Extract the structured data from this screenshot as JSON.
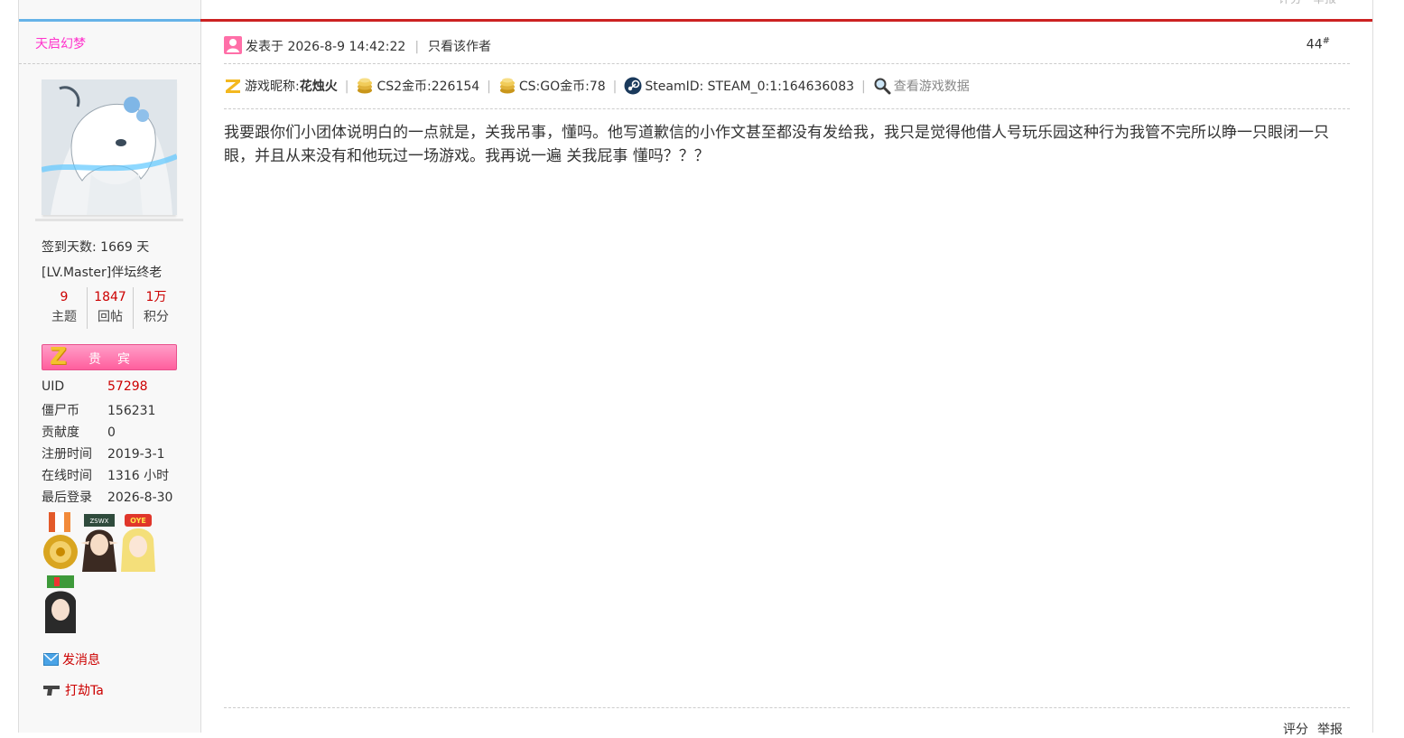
{
  "top_actions": {
    "rate": "评分",
    "report": "举报"
  },
  "sidebar": {
    "username": "天启幻梦",
    "checkin": "签到天数: 1669 天",
    "level": "[LV.Master]伴坛终老",
    "stats": [
      {
        "num": "9",
        "label": "主题"
      },
      {
        "num": "1847",
        "label": "回帖"
      },
      {
        "num": "1万",
        "label": "积分"
      }
    ],
    "vip_label": "贵宾",
    "info": [
      {
        "key": "UID",
        "value": "57298"
      },
      {
        "key": "僵尸币",
        "value": "156231"
      },
      {
        "key": "贡献度",
        "value": "0"
      },
      {
        "key": "注册时间",
        "value": "2019-3-1"
      },
      {
        "key": "在线时间",
        "value": "1316 小时"
      },
      {
        "key": "最后登录",
        "value": "2026-8-30"
      }
    ],
    "send_message": "发消息",
    "rob": "打劫Ta"
  },
  "post": {
    "posted_at": "发表于 2026-8-9 14:42:22",
    "only_author": "只看该作者",
    "floor": "44",
    "floor_mark": "#",
    "game_nick_label": "游戏昵称:",
    "game_nick": "花烛火",
    "cs2_coins": "CS2金币:226154",
    "csgo_coins": "CS:GO金币:78",
    "steam_id": "SteamID: STEAM_0:1:164636083",
    "view_game_data": "查看游戏数据",
    "content": "我要跟你们小团体说明白的一点就是，关我吊事，懂吗。他写道歉信的小作文甚至都没有发给我，我只是觉得他借人号玩乐园这种行为我管不完所以睁一只眼闭一只眼，并且从来没有和他玩过一场游戏。我再说一遍 关我屁事 懂吗？？？",
    "footer_rate": "评分",
    "footer_report": "举报"
  },
  "colors": {
    "accent_red": "#cc2222",
    "sidebar_blue": "#66b3e8",
    "username_pink": "#ff33cc",
    "link_red": "#cc0000"
  }
}
